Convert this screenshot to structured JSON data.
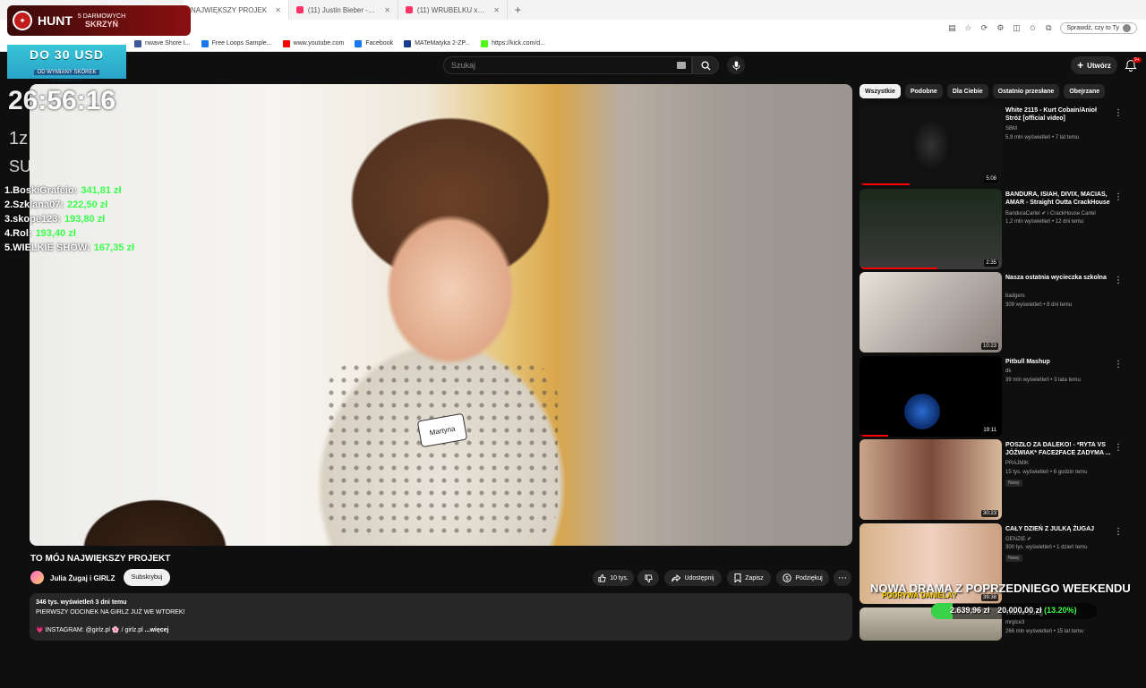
{
  "browser": {
    "tabs": [
      {
        "label": "NAJWIĘKSZY PROJEK",
        "active": true
      },
      {
        "label": "(11) Justin Bieber - Beauty And A",
        "active": false
      },
      {
        "label": "(11) WRUBELKU x JUST WATCH (p",
        "active": false
      }
    ],
    "profile_label": "Sprawdź, czy to Ty",
    "bookmarks": [
      "nwave Shore I...",
      "Free Loops Sample...",
      "www.youtube.com",
      "Facebook",
      "MATeMatyka 2-ZP...",
      "https://kick.com/d..."
    ]
  },
  "overlay": {
    "hunt_title": "HUNT",
    "hunt_sub_top": "5 DARMOWYCH",
    "hunt_sub_bottom": "SKRZYŃ",
    "promo_big": "DO 30 USD",
    "promo_small": "OD WYMIANY SKÓREK",
    "promo_tiny": "PIRATESWAP.COM",
    "timer": "26:56:16",
    "line1": "1z",
    "line2": "SU",
    "leaderboard": [
      {
        "name": "1.BoskiGrafeio:",
        "value": "341,81 zł"
      },
      {
        "name": "2.Szklana07:",
        "value": "222,50 zł"
      },
      {
        "name": "3.skope123:",
        "value": "193,80 zł"
      },
      {
        "name": "4.Rol:",
        "value": "193,40 zł"
      },
      {
        "name": "5.WIELKIE SHOW:",
        "value": "167,35 zł"
      }
    ],
    "goal_title": "NOWA DRAMA Z POPRZEDNIEGO WEEKENDU",
    "goal_tag": "PODRYWA DANIELA?",
    "goal_current": "2.639,96 zł",
    "goal_target": "20.000,00 zł",
    "goal_percent": "(13.20%)",
    "goal_fraction": 0.132
  },
  "header": {
    "search_placeholder": "Szukaj",
    "create_label": "Utwórz",
    "notif_count": "9+"
  },
  "player": {
    "name_tag": "Martyna"
  },
  "video": {
    "title": "TO MÓJ NAJWIĘKSZY PROJEKT",
    "channel": "Julia Żugaj i GIRLZ",
    "subscribe": "Subskrybuj",
    "likes": "10 tys.",
    "share": "Udostępnij",
    "save": "Zapisz",
    "thanks": "Podziękuj",
    "stats": "346 tys. wyświetleń  3 dni temu",
    "desc_line": "PIERWSZY ODCINEK NA GIRLZ JUŻ WE WTOREK!",
    "insta_line": "💗 INSTAGRAM: @girlz.pl 🌸 / girlz.pl",
    "more": "...więcej"
  },
  "sidebar": {
    "chips": [
      "Wszystkie",
      "Podobne",
      "Dla Ciebie",
      "Ostatnio przesłane",
      "Obejrzane"
    ],
    "recs": [
      {
        "title": "White 2115 - Kurt Cobain/Anioł Stróż [official video]",
        "channel": "SBM",
        "meta": "5,9 mln wyświetleń • 7 lat temu",
        "duration": "5:08",
        "badge": "",
        "progress": 0.35
      },
      {
        "title": "BANDURA, ISIAH, DIVIX, MACIAS, AMAR - Straight Outta CrackHouse",
        "channel": "BanduraCartel ✔ i CrackHouse Cartel",
        "meta": "1,2 mln wyświetleń • 12 dni temu",
        "duration": "2:35",
        "badge": "",
        "progress": 0.55
      },
      {
        "title": "Nasza ostatnia wycieczka szkolna",
        "channel": "badgers",
        "meta": "309 wyświetleń • 8 dni temu",
        "duration": "10:23",
        "badge": "",
        "progress": 0
      },
      {
        "title": "Pitbull Mashup",
        "channel": "dk",
        "meta": "39 mln wyświetleń • 3 lata temu",
        "duration": "19:11",
        "badge": "",
        "progress": 0.2
      },
      {
        "title": "POSZŁO ZA DALEKO! - *RYTA VS JÓŹWIAK* FACE2FACE ZADYMA ...",
        "channel": "PRAJMIK",
        "meta": "15 tys. wyświetleń • 6 godzin temu",
        "duration": "30:23",
        "badge": "Nowy",
        "progress": 0
      },
      {
        "title": "CAŁY DZIEŃ Z JULKĄ ŻUGAJ",
        "channel": "GENZIE ✔",
        "meta": "300 tys. wyświetleń • 1 dzień temu",
        "duration": "39:38",
        "badge": "Nowy",
        "progress": 0
      },
      {
        "title": "Theme Song",
        "channel": "mrgice3",
        "meta": "266 mln wyświetleń • 15 lat temu",
        "duration": "",
        "badge": "",
        "progress": 0
      }
    ]
  }
}
